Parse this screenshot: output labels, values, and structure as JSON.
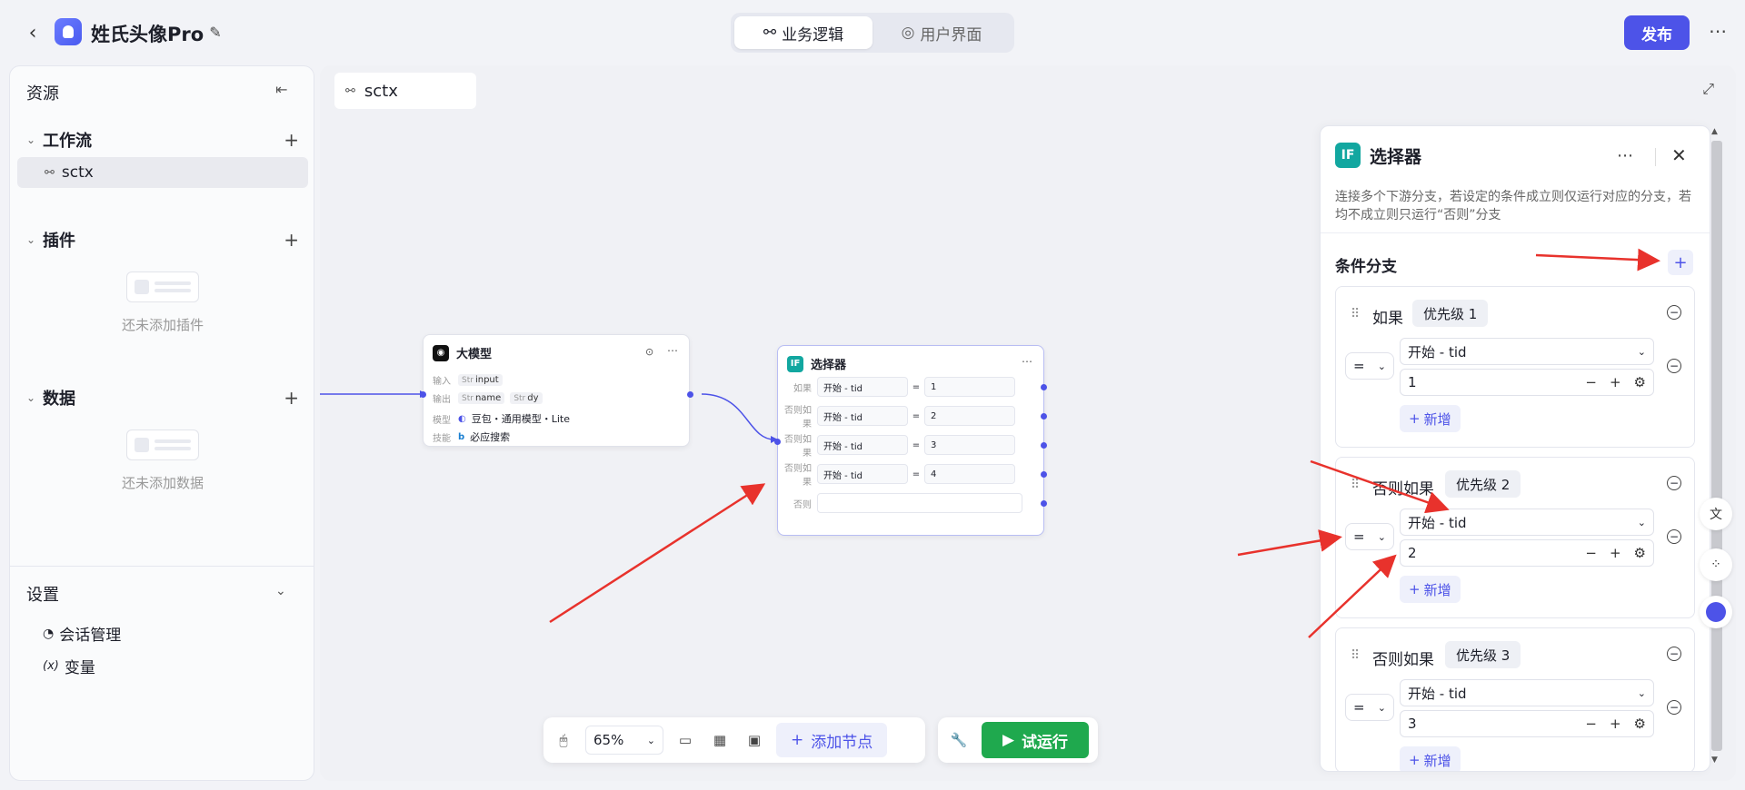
{
  "header": {
    "app_title": "姓氏头像Pro",
    "tabs": [
      {
        "label": "业务逻辑"
      },
      {
        "label": "用户界面"
      }
    ],
    "publish_label": "发布"
  },
  "sidebar": {
    "title": "资源",
    "workflow": {
      "label": "工作流",
      "items": [
        {
          "label": "sctx"
        }
      ]
    },
    "plugins": {
      "label": "插件",
      "empty_text": "还未添加插件"
    },
    "data": {
      "label": "数据",
      "empty_text": "还未添加数据"
    },
    "settings": {
      "label": "设置",
      "items": [
        {
          "label": "会话管理"
        },
        {
          "label": "变量",
          "prefix": "(x)"
        }
      ]
    }
  },
  "canvas": {
    "tab_label": "sctx",
    "llm_node": {
      "title": "大模型",
      "input_label": "输入",
      "input_var": "input",
      "output_label": "输出",
      "output_vars": [
        "name",
        "dy"
      ],
      "model_label": "模型",
      "model_value": "豆包・通用模型・Lite",
      "skill_label": "技能",
      "skill_value": "必应搜索",
      "type_tag": "Str"
    },
    "selector_node": {
      "title": "选择器",
      "rows": [
        {
          "label": "如果",
          "field": "开始 - tid",
          "op": "=",
          "value": "1"
        },
        {
          "label": "否则如果",
          "field": "开始 - tid",
          "op": "=",
          "value": "2"
        },
        {
          "label": "否则如果",
          "field": "开始 - tid",
          "op": "=",
          "value": "3"
        },
        {
          "label": "否则如果",
          "field": "开始 - tid",
          "op": "=",
          "value": "4"
        },
        {
          "label": "否则",
          "field": "",
          "op": "",
          "value": ""
        }
      ]
    }
  },
  "toolbar": {
    "zoom": "65%",
    "add_node_label": "添加节点",
    "run_label": "试运行"
  },
  "panel": {
    "icon_text": "IF",
    "title": "选择器",
    "description": "连接多个下游分支，若设定的条件成立则仅运行对应的分支，若均不成立则只运行“否则”分支",
    "section_title": "条件分支",
    "new_label": "新增",
    "branches": [
      {
        "title": "如果",
        "priority": "优先级 1",
        "op": "=",
        "field": "开始 - tid",
        "value": "1"
      },
      {
        "title": "否则如果",
        "priority": "优先级 2",
        "op": "=",
        "field": "开始 - tid",
        "value": "2"
      },
      {
        "title": "否则如果",
        "priority": "优先级 3",
        "op": "=",
        "field": "开始 - tid",
        "value": "3"
      }
    ]
  },
  "colors": {
    "accent": "#4d53e8",
    "run_green": "#1fa94e",
    "selector_teal": "#12a7a0",
    "arrow_red": "#e8322c"
  }
}
